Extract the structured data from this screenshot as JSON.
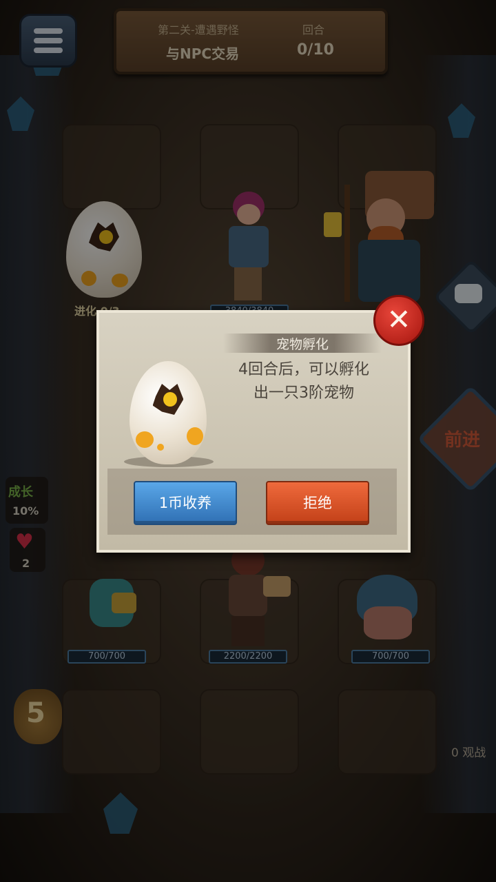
{
  "banner": {
    "stage": "第二关-遭遇野怪",
    "task": "与NPC交易",
    "round_label": "回合",
    "round_value": "0/10"
  },
  "board": {
    "egg_evolve_label": "进化 0/3",
    "hero_top_hp": "3840/3840",
    "units_bottom": [
      {
        "hp": "700/700"
      },
      {
        "hp": "2200/2200"
      },
      {
        "hp": "700/700"
      }
    ],
    "forward_label": "前进"
  },
  "stats": {
    "growth_label": "成长",
    "growth_value": "10%",
    "lives": "2",
    "coins": "5",
    "spectators": "0 观战"
  },
  "popup": {
    "title": "宠物孵化",
    "desc_line1": "4回合后，可以孵化",
    "desc_line2": "出一只3阶宠物",
    "accept_label": "1币收养",
    "refuse_label": "拒绝",
    "close_label": "✕"
  },
  "icons": {
    "menu": "menu-icon",
    "chat": "chat-icon",
    "heart": "heart-icon",
    "coin_bag": "coin-bag-icon",
    "close": "close-icon"
  },
  "colors": {
    "accept": "#2f6fb3",
    "refuse": "#c24018",
    "close": "#a4150e"
  }
}
